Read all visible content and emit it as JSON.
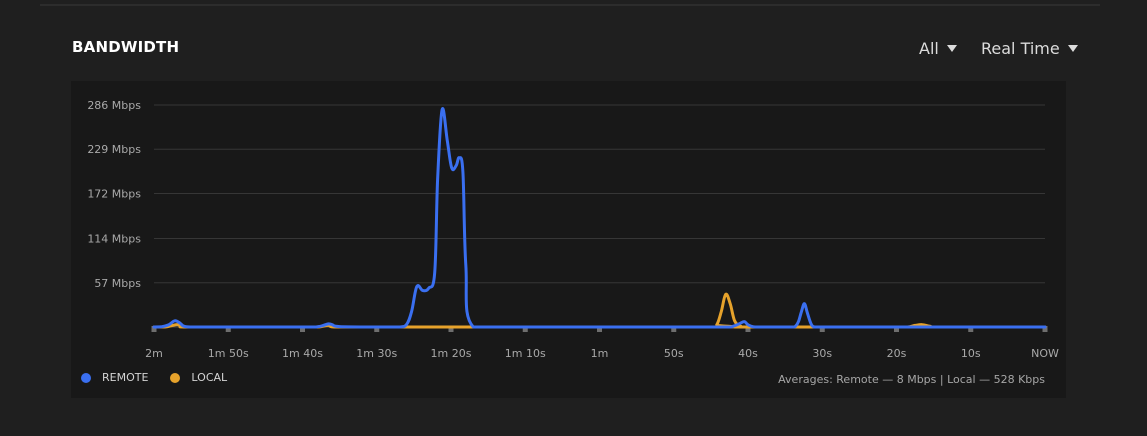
{
  "header": {
    "title": "BANDWIDTH",
    "filter_label": "All",
    "range_label": "Real Time"
  },
  "colors": {
    "remote": "#3a6ff0",
    "local": "#e6a22b",
    "grid": "#363636"
  },
  "legend": {
    "remote_label": "REMOTE",
    "local_label": "LOCAL",
    "averages_text": "Averages: Remote — 8 Mbps | Local — 528 Kbps"
  },
  "chart_data": {
    "type": "line",
    "title": "BANDWIDTH",
    "xlabel": "",
    "ylabel": "",
    "y_ticks": [
      {
        "value": 57,
        "label": "57 Mbps"
      },
      {
        "value": 114,
        "label": "114 Mbps"
      },
      {
        "value": 172,
        "label": "172 Mbps"
      },
      {
        "value": 229,
        "label": "229 Mbps"
      },
      {
        "value": 286,
        "label": "286 Mbps"
      }
    ],
    "ylim": [
      0,
      286
    ],
    "xlim": [
      120,
      0
    ],
    "x_ticks": [
      {
        "value": 120,
        "label": "2m"
      },
      {
        "value": 110,
        "label": "1m 50s"
      },
      {
        "value": 100,
        "label": "1m 40s"
      },
      {
        "value": 90,
        "label": "1m 30s"
      },
      {
        "value": 80,
        "label": "1m 20s"
      },
      {
        "value": 70,
        "label": "1m 10s"
      },
      {
        "value": 60,
        "label": "1m"
      },
      {
        "value": 50,
        "label": "50s"
      },
      {
        "value": 40,
        "label": "40s"
      },
      {
        "value": 30,
        "label": "30s"
      },
      {
        "value": 20,
        "label": "20s"
      },
      {
        "value": 10,
        "label": "10s"
      },
      {
        "value": 0,
        "label": "NOW"
      }
    ],
    "grid": true,
    "legend_position": "bottom-left",
    "series": [
      {
        "name": "REMOTE",
        "x": [
          120,
          119,
          118,
          117.2,
          116.5,
          116,
          115,
          114,
          100,
          98,
          97.2,
          96.5,
          96,
          95,
          90,
          87,
          86,
          85.3,
          84.6,
          83.8,
          83,
          82.2,
          81.8,
          81.2,
          80.5,
          79.9,
          79.3,
          78.9,
          78.4,
          78,
          77,
          70,
          60,
          50,
          43,
          42,
          41.2,
          40.5,
          40,
          39,
          36,
          34,
          33.6,
          33.2,
          32.8,
          32.4,
          32,
          31.5,
          31,
          30,
          20,
          10,
          0
        ],
        "y": [
          0,
          0.3,
          3,
          8,
          5,
          1,
          0,
          0,
          0,
          0.3,
          2,
          4,
          3,
          0.5,
          0,
          0,
          3,
          20,
          52,
          47,
          50,
          70,
          190,
          280,
          240,
          205,
          208,
          218,
          200,
          80,
          0,
          0,
          0,
          0,
          0,
          1,
          4,
          7,
          3,
          0,
          0,
          0,
          1,
          7,
          20,
          30,
          18,
          4,
          0,
          0,
          0,
          0,
          0
        ]
      },
      {
        "name": "LOCAL",
        "x": [
          120,
          118.5,
          117.5,
          116.8,
          116,
          115,
          100,
          98,
          97.2,
          96.5,
          95.5,
          90,
          45,
          44.2,
          43.6,
          43,
          42.4,
          41.8,
          41,
          40,
          20,
          18.5,
          17.5,
          16.5,
          15.5,
          14,
          0
        ],
        "y": [
          0,
          0,
          2,
          3,
          1,
          0,
          0,
          0,
          1,
          2,
          0,
          0,
          0,
          3,
          20,
          42,
          30,
          8,
          1,
          0,
          0,
          0,
          2,
          3,
          1,
          0,
          0
        ]
      }
    ]
  }
}
